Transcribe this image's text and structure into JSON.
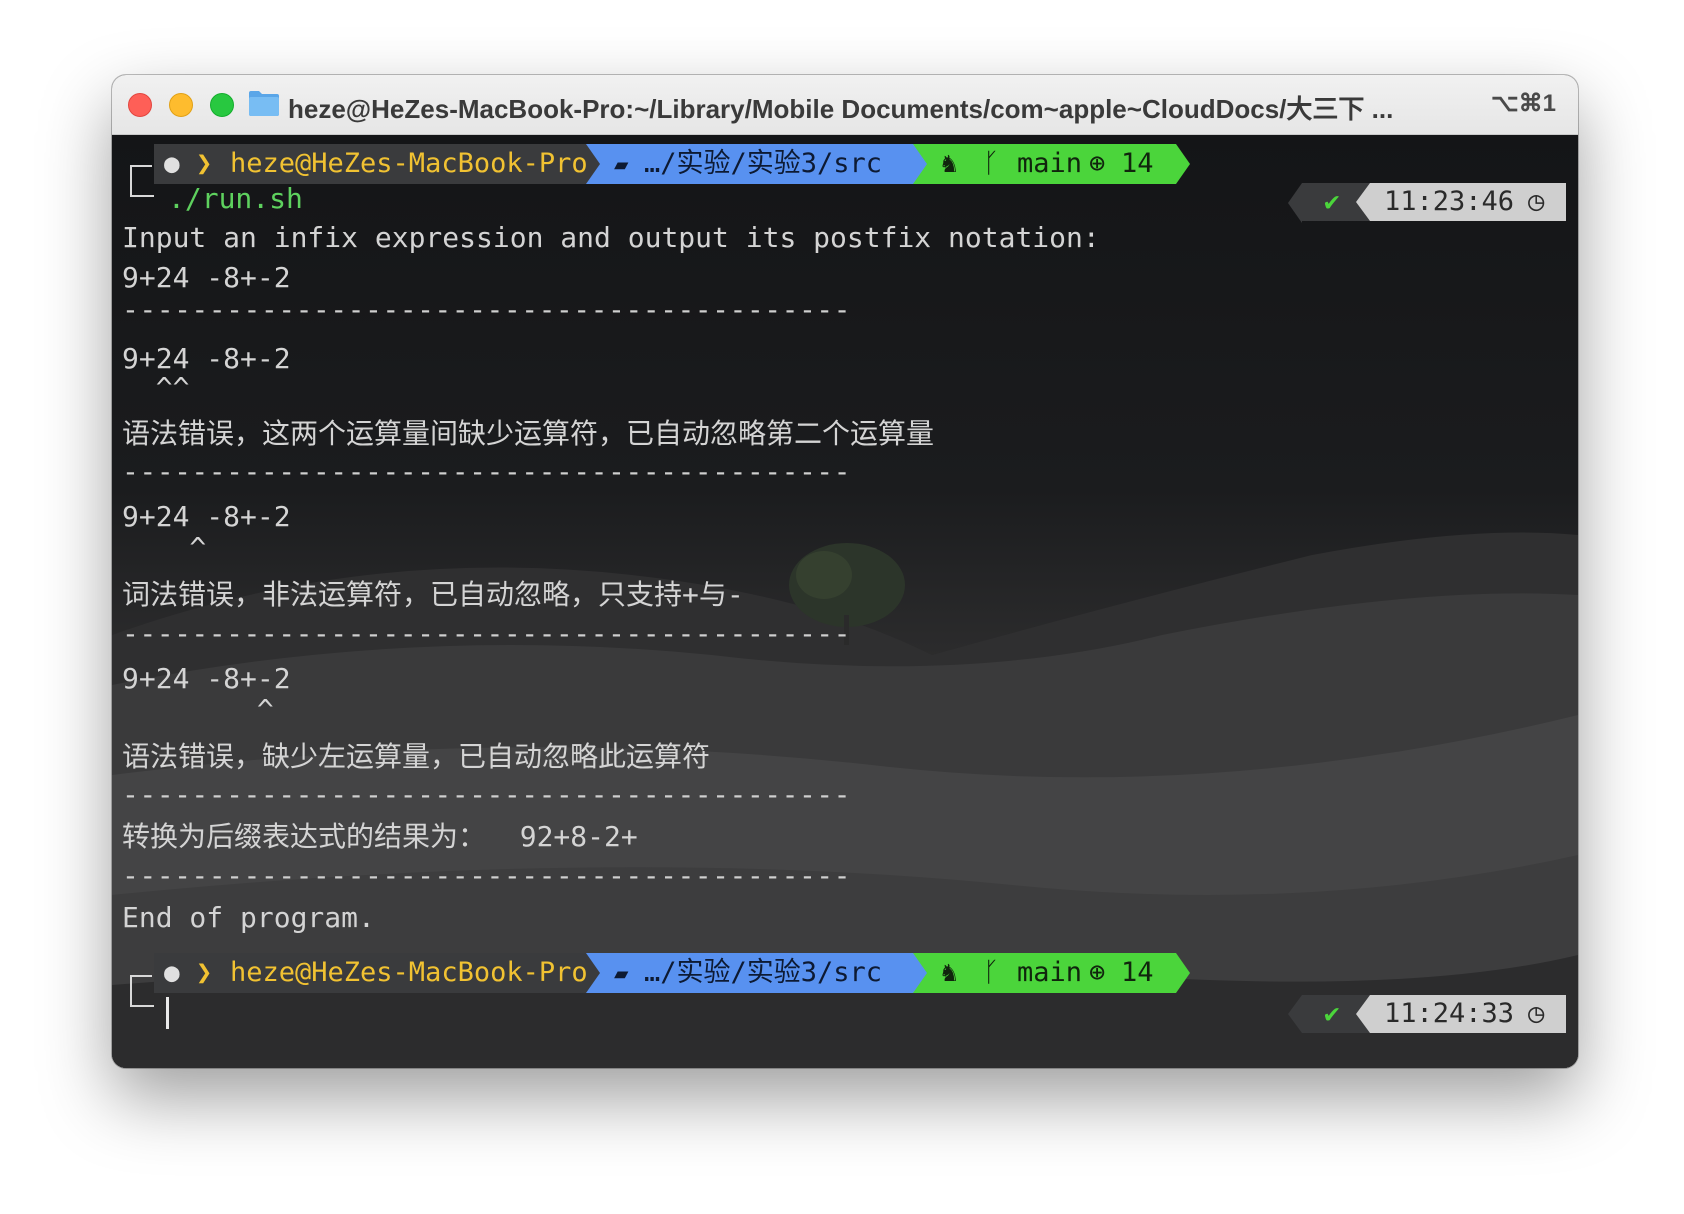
{
  "window": {
    "title": "heze@HeZes-MacBook-Pro:~/Library/Mobile Documents/com~apple~CloudDocs/大三下 ...",
    "shortcut": "⌥⌘1"
  },
  "prompt1": {
    "host": "heze@HeZes-MacBook-Pro",
    "path": "…/实验/实验3/src",
    "branch": "main",
    "ahead": "14",
    "command": "./run.sh",
    "time": "11:23:46"
  },
  "output": {
    "intro": "Input an infix expression and output its postfix notation:",
    "input": "9+24 -8+-2",
    "separator": "------------------------------------------",
    "err1_expr": "9+24 -8+-2",
    "err1_marker": "  ^^",
    "err1_msg": "语法错误，这两个运算量间缺少运算符，已自动忽略第二个运算量",
    "err2_expr": "9+24 -8+-2",
    "err2_marker": "    ^",
    "err2_msg": "词法错误，非法运算符，已自动忽略，只支持+与-",
    "err3_expr": "9+24 -8+-2",
    "err3_marker": "        ^",
    "err3_msg": "语法错误，缺少左运算量，已自动忽略此运算符",
    "result": "转换为后缀表达式的结果为：  92+8-2+",
    "end": "End of program."
  },
  "prompt2": {
    "host": "heze@HeZes-MacBook-Pro",
    "path": "…/实验/实验3/src",
    "branch": "main",
    "ahead": "14",
    "time": "11:24:33"
  },
  "colors": {
    "host_segment": "#3a3b3d",
    "host_text": "#f1c232",
    "path_segment": "#5891f0",
    "git_segment": "#4bd53b",
    "time_segment": "#cfcfcf",
    "command": "#5ed15e"
  },
  "icons": [
    "apple-icon",
    "chevron-right-icon",
    "folder-open-icon",
    "github-cat-icon",
    "git-branch-icon",
    "arrow-up-circle-icon",
    "check-icon",
    "clock-icon"
  ]
}
